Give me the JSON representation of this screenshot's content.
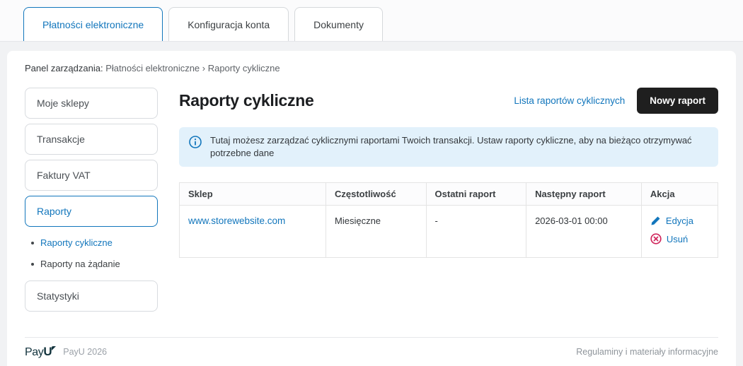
{
  "tabs": [
    {
      "label": "Płatności elektroniczne"
    },
    {
      "label": "Konfiguracja konta"
    },
    {
      "label": "Dokumenty"
    }
  ],
  "breadcrumb": {
    "prefix": "Panel zarządzania:",
    "path": "Płatności elektroniczne › Raporty cykliczne"
  },
  "sidebar": {
    "items": [
      {
        "label": "Moje sklepy"
      },
      {
        "label": "Transakcje"
      },
      {
        "label": "Faktury VAT"
      },
      {
        "label": "Raporty"
      },
      {
        "label": "Statystyki"
      }
    ],
    "subitems": [
      {
        "label": "Raporty cykliczne"
      },
      {
        "label": "Raporty na żądanie"
      }
    ]
  },
  "main": {
    "title": "Raporty cykliczne",
    "list_link": "Lista raportów cyklicznych",
    "new_report_button": "Nowy raport",
    "info_text": "Tutaj możesz zarządzać cyklicznymi raportami Twoich transakcji. Ustaw raporty cykliczne, aby na bieżąco otrzymywać potrzebne dane",
    "table": {
      "headers": [
        "Sklep",
        "Częstotliwość",
        "Ostatni raport",
        "Następny raport",
        "Akcja"
      ],
      "rows": [
        {
          "shop": "www.storewebsite.com",
          "frequency": "Miesięczne",
          "last_report": "-",
          "next_report": "2026-03-01 00:00",
          "edit_label": "Edycja",
          "delete_label": "Usuń"
        }
      ]
    }
  },
  "footer": {
    "logo_pay": "Pay",
    "logo_u": "U",
    "copyright": "PayU 2026",
    "legal_link": "Regulaminy i materiały informacyjne"
  },
  "colors": {
    "accent_blue": "#1276bc",
    "button_black": "#1f1f1f",
    "delete_red": "#d0265c",
    "info_bg": "#e2f1fb"
  }
}
